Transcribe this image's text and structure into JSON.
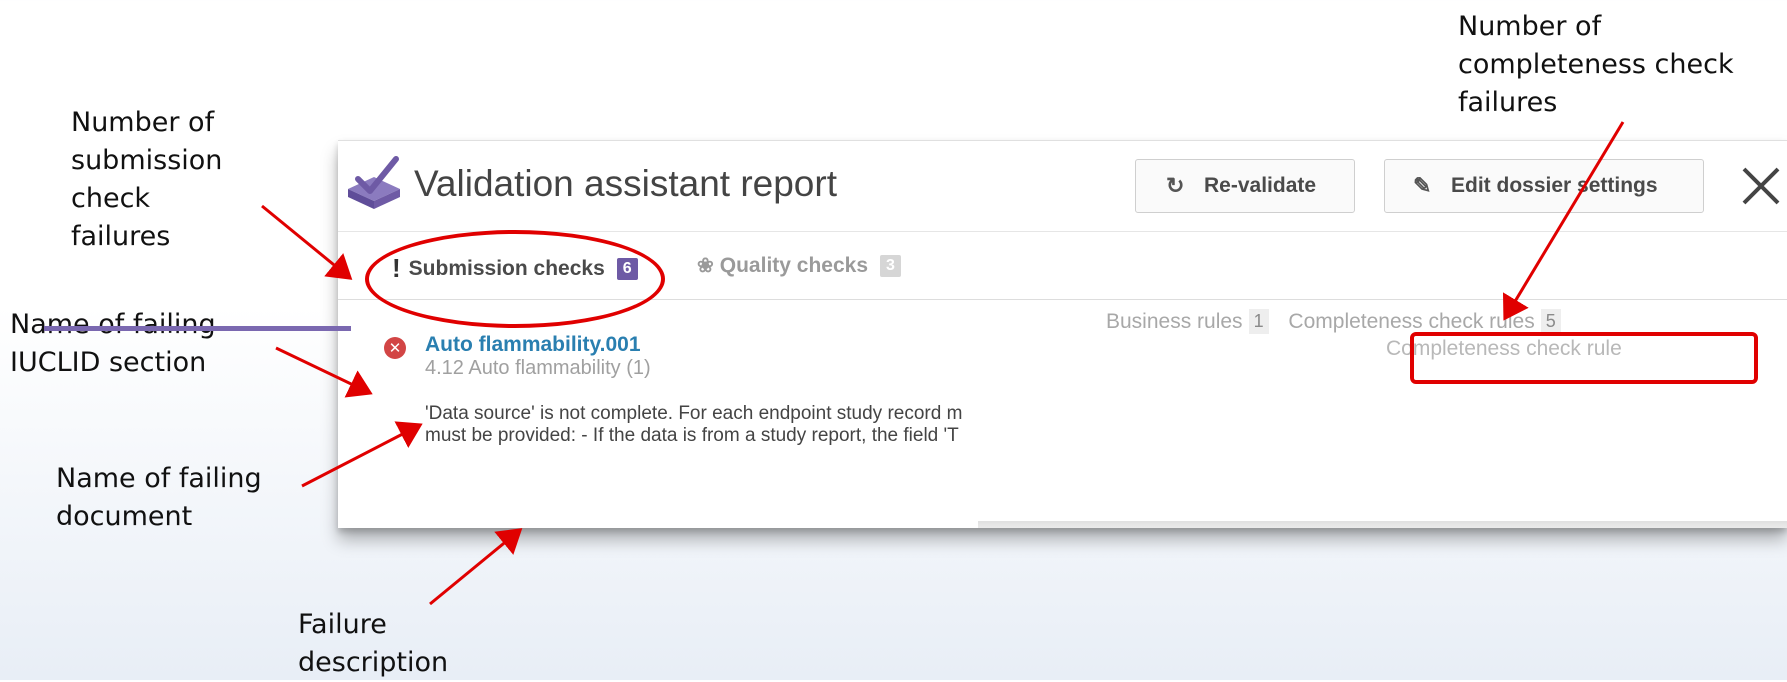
{
  "annotations": {
    "submission_failures": [
      "Number of",
      "submission",
      "check",
      "failures"
    ],
    "failing_section": [
      "Name of failing",
      "IUCLID section"
    ],
    "failing_document": [
      "Name of failing",
      "document"
    ],
    "failure_description": [
      "Failure",
      "description"
    ],
    "completeness_failures": [
      "Number of",
      "completeness check",
      "failures"
    ]
  },
  "window": {
    "title": "Validation assistant report",
    "revalidate_label": "Re-validate",
    "edit_settings_label": "Edit dossier settings"
  },
  "tabs": {
    "submission": {
      "label": "Submission checks",
      "count": "6"
    },
    "quality": {
      "label": "Quality checks",
      "count": "3"
    }
  },
  "rules": {
    "business": {
      "label": "Business rules",
      "count": "1"
    },
    "completeness": {
      "label": "Completeness check rules",
      "count": "5"
    },
    "sub_label": "Completeness check rule"
  },
  "result": {
    "title": "Auto flammability.001",
    "section": "4.12 Auto flammability (1)",
    "description_line1": "'Data source' is not complete. For each endpoint study record m",
    "description_line2": "must be provided: - If the data is from a study report, the field 'T"
  },
  "colors": {
    "accent_purple": "#6e5aa5",
    "annotation_red": "#e00000",
    "link_blue": "#2a7fb0",
    "error_red": "#d24545"
  },
  "icons": [
    "validation-app-icon",
    "refresh-icon",
    "pencil-icon",
    "close-icon",
    "exclamation-icon",
    "ribbon-icon",
    "error-icon"
  ]
}
